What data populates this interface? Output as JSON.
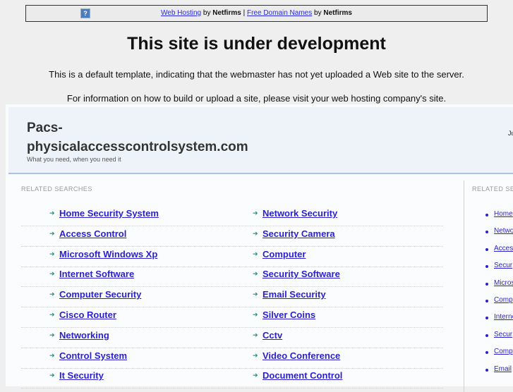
{
  "topbar": {
    "link1": "Web Hosting",
    "by1": "by",
    "brand1": "Netfirms",
    "sep": "|",
    "link2": "Free Domain Names",
    "by2": "by",
    "brand2": "Netfirms"
  },
  "heading": "This site is under development",
  "para1": "This is a default template, indicating that the webmaster has not yet uploaded a Web site to the server.",
  "para2": "For information on how to build or upload a site, please visit your web hosting company's site.",
  "site": {
    "title_line1": "Pacs-",
    "title_line2": "physicalaccesscontrolsystem.com",
    "tagline": "What you need, when you need it",
    "date_partial": "Ju"
  },
  "related_label": "RELATED SEARCHES",
  "side_label": "RELATED SE",
  "left_links": [
    "Home Security System",
    "Access Control",
    "Microsoft Windows Xp",
    "Internet Software",
    "Computer Security",
    "Cisco Router",
    "Networking",
    "Control System",
    "It Security"
  ],
  "right_links": [
    "Network Security",
    "Security Camera",
    "Computer",
    "Security Software",
    "Email Security",
    "Silver Coins",
    "Cctv",
    "Video Conference",
    "Document Control"
  ],
  "side_links": [
    "Home",
    "Netwo",
    "Acces",
    "Secur",
    "Micros",
    "Comp",
    "Interne",
    "Secur",
    "Comp",
    "Email"
  ]
}
